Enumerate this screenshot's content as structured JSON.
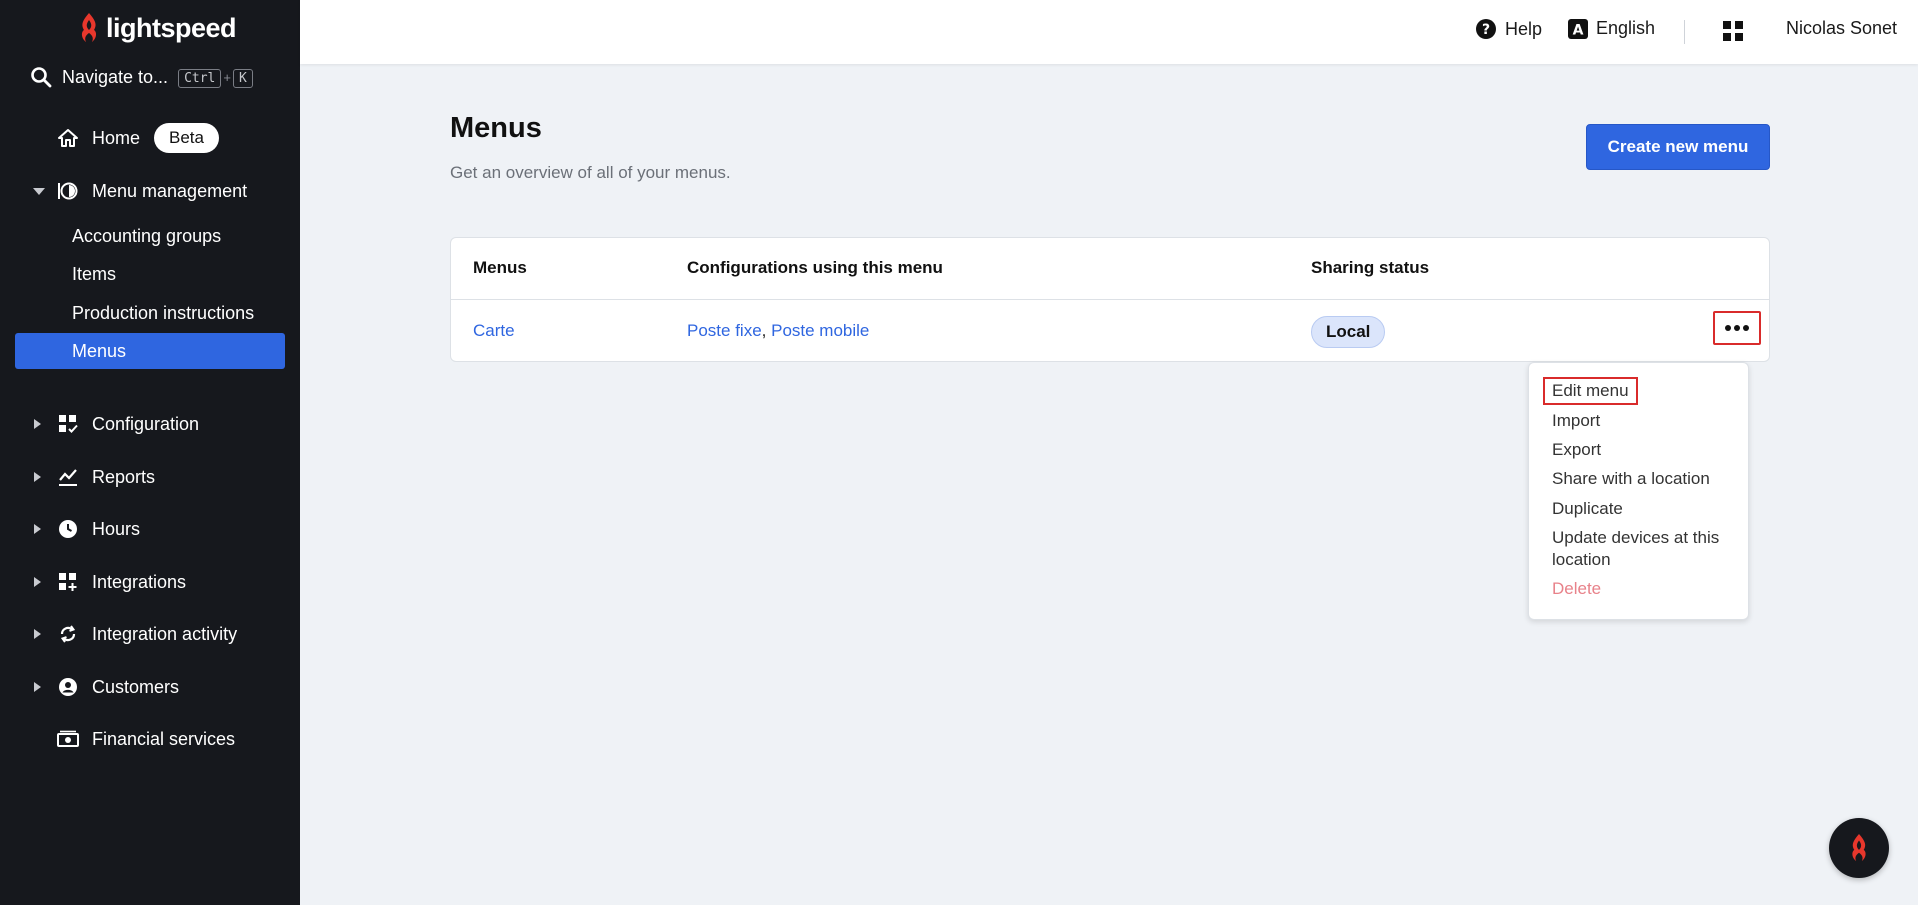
{
  "brand": {
    "name": "lightspeed",
    "accent": "#2f66e0",
    "logo_color": "#e8372c"
  },
  "sidebar": {
    "search": {
      "label": "Navigate to...",
      "shortcut_keys": [
        "Ctrl",
        "K"
      ],
      "shortcut_joiner": "+"
    },
    "home": {
      "label": "Home",
      "badge": "Beta"
    },
    "menu_management": {
      "label": "Menu management",
      "children": [
        {
          "label": "Accounting groups"
        },
        {
          "label": "Items"
        },
        {
          "label": "Production instructions"
        },
        {
          "label": "Menus",
          "active": true
        }
      ]
    },
    "sections": [
      {
        "label": "Configuration",
        "icon": "grid-check-icon"
      },
      {
        "label": "Reports",
        "icon": "chart-icon"
      },
      {
        "label": "Hours",
        "icon": "clock-icon"
      },
      {
        "label": "Integrations",
        "icon": "grid-plus-icon"
      },
      {
        "label": "Integration activity",
        "icon": "sync-icon"
      },
      {
        "label": "Customers",
        "icon": "user-circle-icon"
      },
      {
        "label": "Financial services",
        "icon": "cash-icon"
      }
    ]
  },
  "header": {
    "help": "Help",
    "language": "English",
    "user": "Nicolas Sonet"
  },
  "page": {
    "title": "Menus",
    "subtitle": "Get an overview of all of your menus.",
    "create_button": "Create new menu"
  },
  "table": {
    "headers": [
      "Menus",
      "Configurations using this menu",
      "Sharing status"
    ],
    "rows": [
      {
        "menu": "Carte",
        "configurations": [
          "Poste fixe",
          "Poste mobile"
        ],
        "config_separator": ", ",
        "status": "Local"
      }
    ]
  },
  "dropdown": {
    "items": [
      {
        "label": "Edit menu"
      },
      {
        "label": "Import"
      },
      {
        "label": "Export"
      },
      {
        "label": "Share with a location"
      },
      {
        "label": "Duplicate"
      },
      {
        "label": "Update devices at this location"
      },
      {
        "label": "Delete"
      }
    ]
  }
}
